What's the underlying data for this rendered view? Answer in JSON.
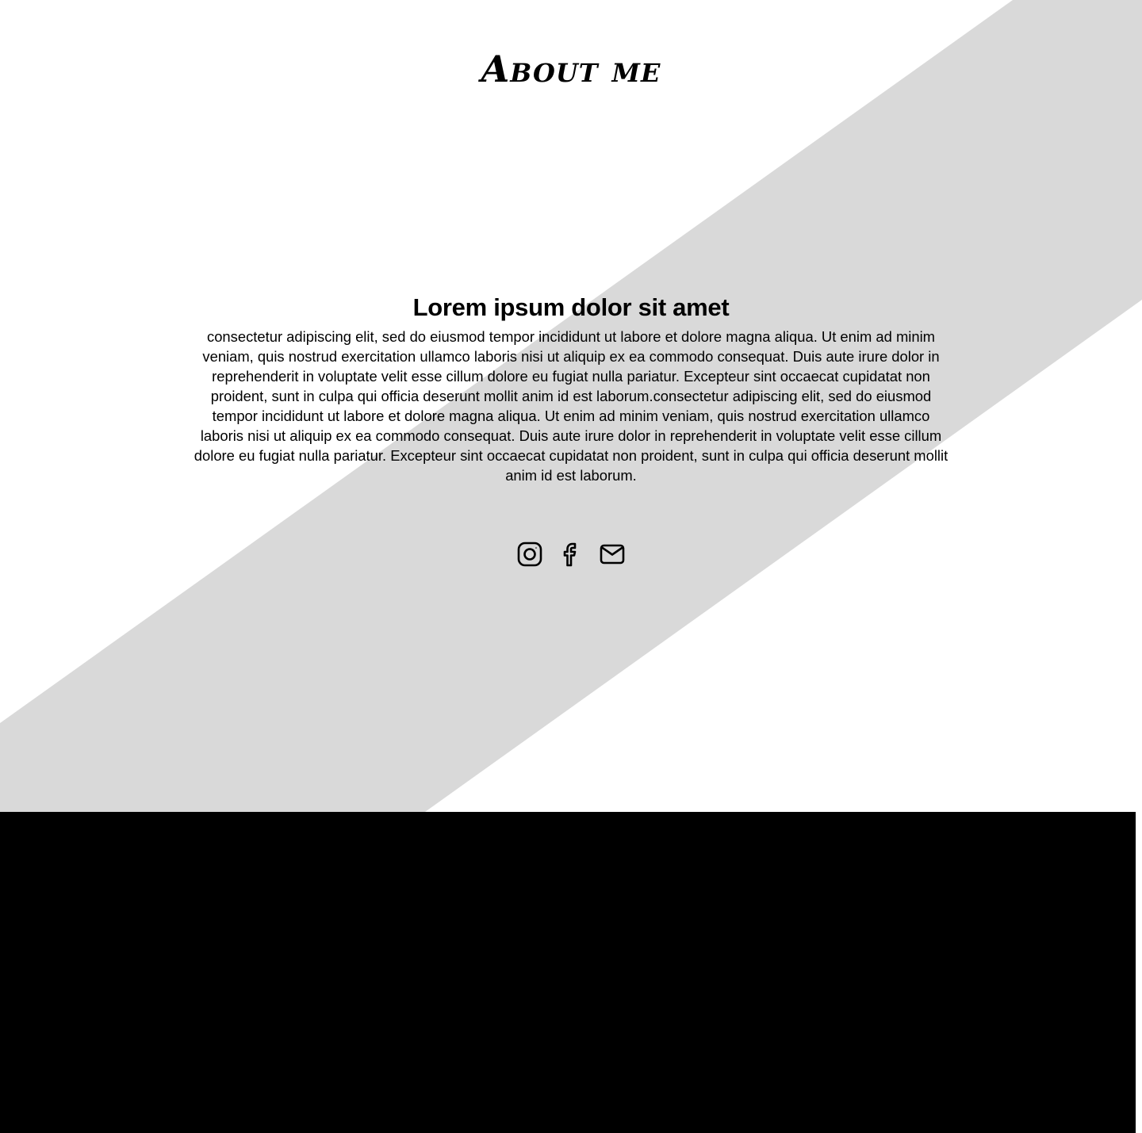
{
  "about": {
    "title": "About me",
    "headline": "Lorem ipsum dolor sit amet",
    "body": "consectetur adipiscing elit, sed do eiusmod tempor incididunt ut labore et dolore magna aliqua. Ut enim ad minim veniam, quis nostrud exercitation ullamco laboris nisi ut aliquip ex ea commodo consequat. Duis aute irure dolor in reprehenderit in voluptate velit esse cillum dolore eu fugiat nulla pariatur. Excepteur sint occaecat cupidatat non proident, sunt in culpa qui officia deserunt mollit anim id est laborum.consectetur adipiscing elit, sed do eiusmod tempor incididunt ut labore et dolore magna aliqua. Ut enim ad minim veniam, quis nostrud exercitation ullamco laboris nisi ut aliquip ex ea commodo consequat. Duis aute irure dolor in reprehenderit in voluptate velit esse cillum dolore eu fugiat nulla pariatur. Excepteur sint occaecat cupidatat non proident, sunt in culpa qui officia deserunt mollit anim id est laborum."
  },
  "socials": [
    {
      "icon": "instagram-icon"
    },
    {
      "icon": "facebook-icon"
    },
    {
      "icon": "mail-icon"
    }
  ],
  "colors": {
    "background": "#ffffff",
    "stripe": "#d9d9d9",
    "footer": "#000000",
    "text": "#000000"
  }
}
